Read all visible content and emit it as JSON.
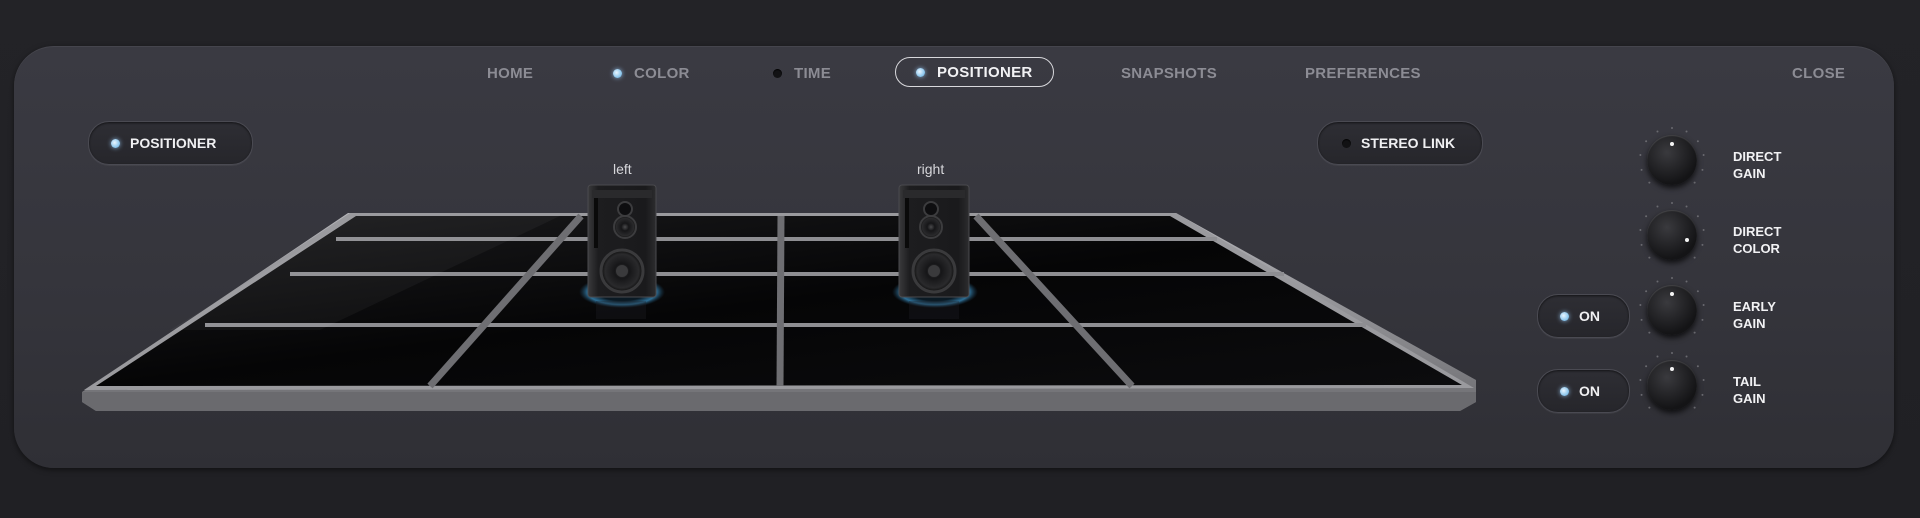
{
  "nav": {
    "home": "HOME",
    "color": "COLOR",
    "time": "TIME",
    "positioner": "POSITIONER",
    "snapshots": "SNAPSHOTS",
    "preferences": "PREFERENCES",
    "close": "CLOSE",
    "color_led": "on",
    "time_led": "off",
    "positioner_led": "on"
  },
  "toggles": {
    "positioner": {
      "label": "POSITIONER",
      "led": "on"
    },
    "stereo_link": {
      "label": "STEREO LINK",
      "led": "off"
    },
    "early_gain_on": {
      "label": "ON",
      "led": "on"
    },
    "tail_gain_on": {
      "label": "ON",
      "led": "on"
    }
  },
  "speakers": {
    "left": "left",
    "right": "right"
  },
  "knobs": [
    {
      "line1": "DIRECT",
      "line2": "GAIN",
      "value": 0.5
    },
    {
      "line1": "DIRECT",
      "line2": "COLOR",
      "value": 0.9
    },
    {
      "line1": "EARLY",
      "line2": "GAIN",
      "value": 0.5
    },
    {
      "line1": "TAIL",
      "line2": "GAIN",
      "value": 0.5
    }
  ],
  "colors": {
    "accent_led": "#8fc8ee",
    "panel": "#38383f",
    "background": "#222226"
  }
}
